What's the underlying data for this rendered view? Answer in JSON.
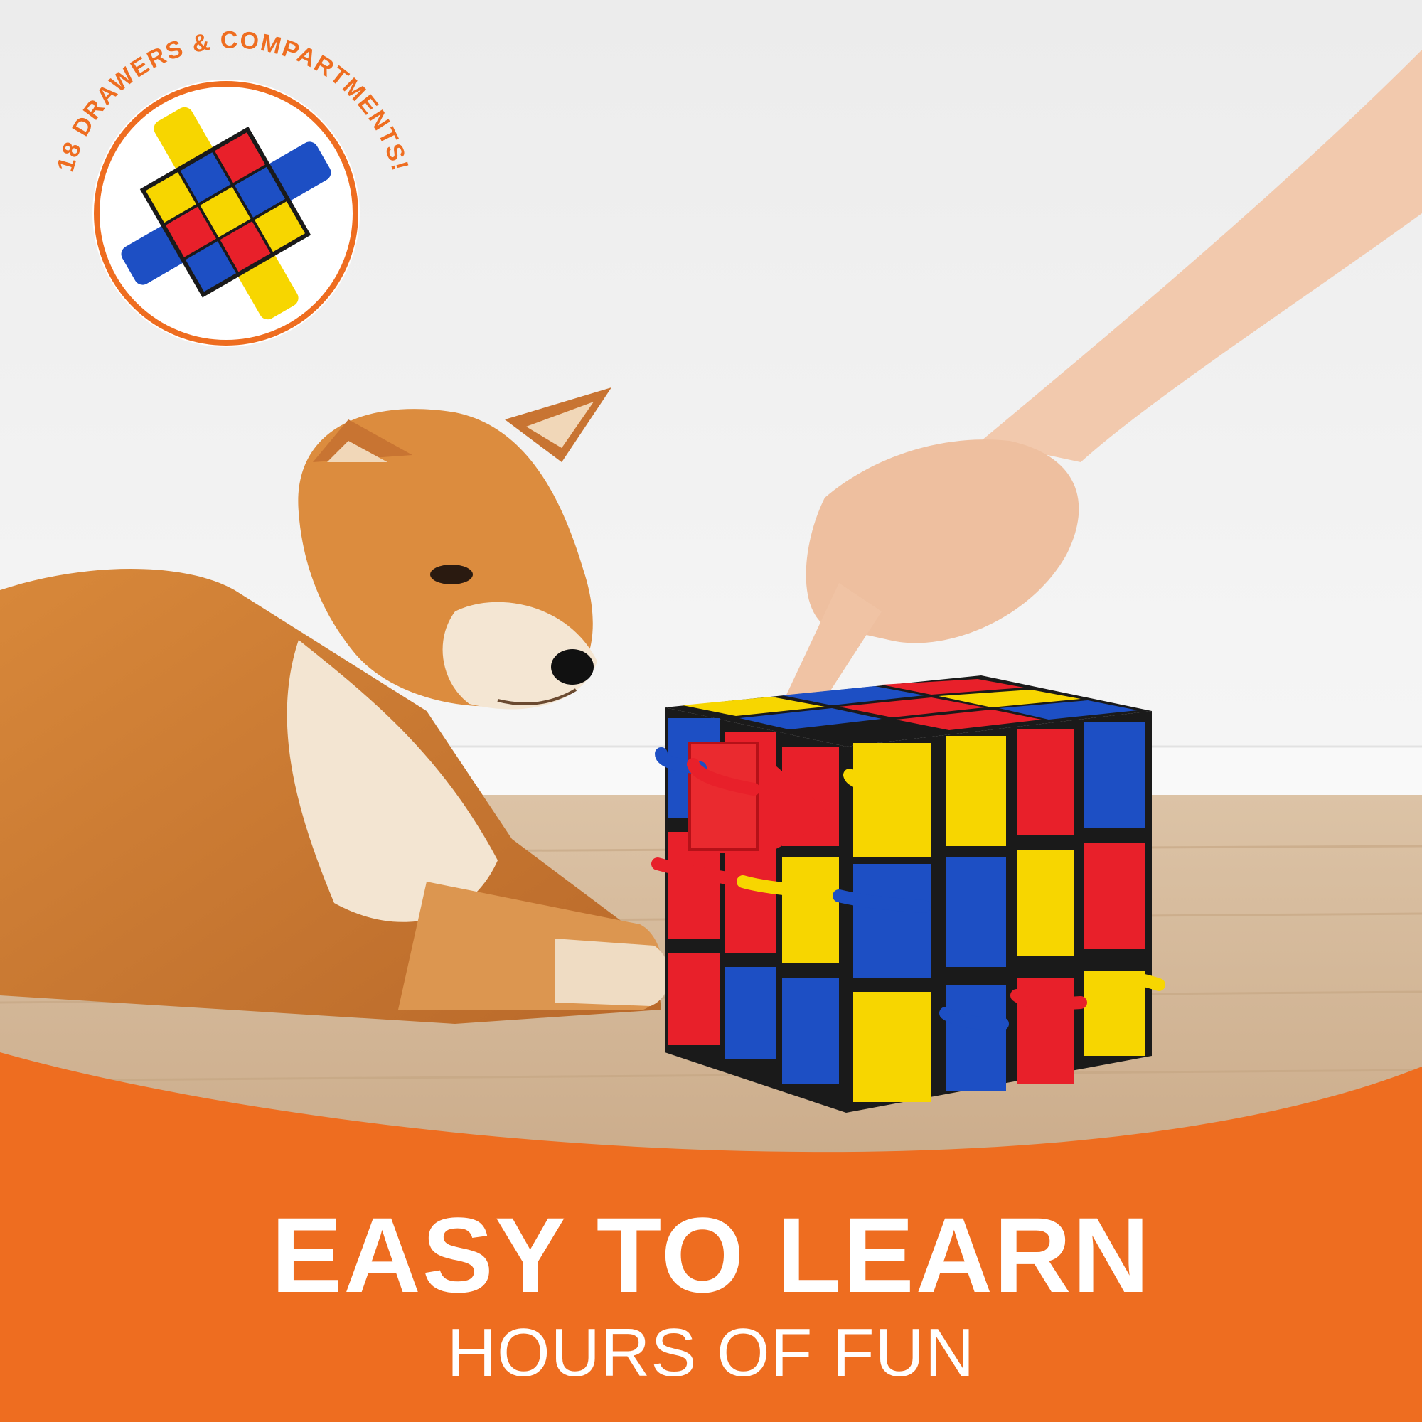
{
  "badge": {
    "arc_text": "18 DRAWERS & COMPARTMENTS!",
    "icon": "puzzle-cube-unfolded-illustration"
  },
  "headline": "EASY TO LEARN",
  "subheadline": "HOURS OF FUN",
  "photo": {
    "subject": "dog-photo",
    "product": "puzzle-cube-toy-photo"
  },
  "colors": {
    "brand_orange": "#ee6d20",
    "cube_red": "#e8202a",
    "cube_yellow": "#f7d600",
    "cube_blue": "#1d4fc4",
    "cube_frame": "#1a1a1a"
  }
}
